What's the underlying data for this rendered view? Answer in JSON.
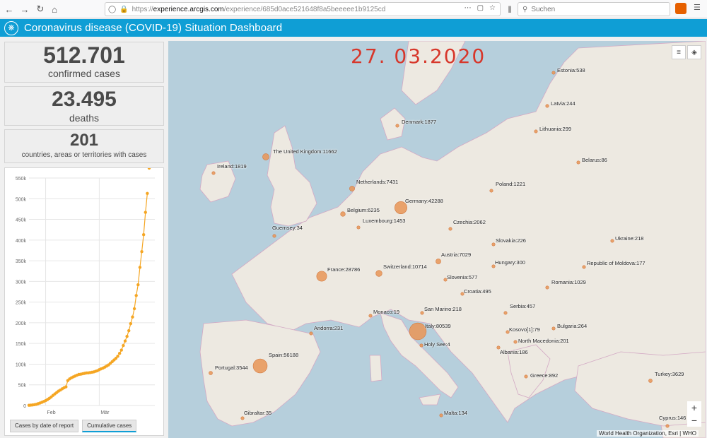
{
  "browser": {
    "url_scheme": "https://",
    "url_domain": "experience.arcgis.com",
    "url_path": "/experience/685d0ace521648f8a5beeeee1b9125cd",
    "search_placeholder": "Suchen"
  },
  "header": {
    "title": "Coronavirus disease (COVID-19) Situation Dashboard",
    "logo_icon": "who-emblem-icon"
  },
  "stats": {
    "confirmed_value": "512.701",
    "confirmed_label": "confirmed cases",
    "deaths_value": "23.495",
    "deaths_label": "deaths",
    "countries_value": "201",
    "countries_label": "countries, areas or territories with cases"
  },
  "chart_tabs": {
    "by_date": "Cases by date of report",
    "cumulative": "Cumulative cases"
  },
  "chart_data": {
    "type": "scatter",
    "ytick_labels": [
      "0",
      "50k",
      "100k",
      "150k",
      "200k",
      "250k",
      "300k",
      "350k",
      "400k",
      "450k",
      "500k",
      "550k"
    ],
    "xtick_labels": [
      "Feb",
      "Mär"
    ],
    "ylim": [
      0,
      550000
    ],
    "color": "#f5a623",
    "x": [
      1,
      2,
      3,
      4,
      5,
      6,
      7,
      8,
      9,
      10,
      11,
      12,
      13,
      14,
      15,
      16,
      17,
      18,
      19,
      20,
      21,
      22,
      23,
      24,
      25,
      26,
      27,
      28,
      29,
      30,
      31,
      32,
      33,
      34,
      35,
      36,
      37,
      38,
      39,
      40,
      41,
      42,
      43,
      44,
      45,
      46,
      47,
      48,
      49,
      50,
      51,
      52,
      53,
      54,
      55,
      56,
      57,
      58,
      59,
      60,
      61,
      62,
      63,
      64,
      65,
      66
    ],
    "y": [
      580,
      850,
      1300,
      2000,
      2800,
      4600,
      6000,
      7800,
      9800,
      11900,
      14500,
      17300,
      20500,
      24500,
      28000,
      31400,
      34900,
      37500,
      40500,
      43100,
      45100,
      60300,
      64400,
      67100,
      69200,
      71300,
      73300,
      75200,
      75700,
      76700,
      77700,
      78600,
      78900,
      79500,
      80400,
      81300,
      82700,
      84100,
      86600,
      88600,
      90400,
      92800,
      95300,
      98000,
      102000,
      106000,
      110000,
      114000,
      119000,
      126000,
      134000,
      145000,
      156000,
      167000,
      181000,
      198000,
      214000,
      234000,
      266000,
      292000,
      334000,
      372000,
      413000,
      467000,
      512701
    ],
    "grid": true
  },
  "map": {
    "date": "27. 03.2020",
    "attribution": "World Health Organization, Esri | WHO",
    "legend_icon": "list-icon",
    "layers_icon": "layers-icon",
    "zoom_in": "+",
    "zoom_out": "−",
    "markers": [
      {
        "label": "Estonia:538",
        "cases": 538
      },
      {
        "label": "Latvia:244",
        "cases": 244
      },
      {
        "label": "Lithuania:299",
        "cases": 299
      },
      {
        "label": "Denmark:1877",
        "cases": 1877
      },
      {
        "label": "Belarus:86",
        "cases": 86
      },
      {
        "label": "The United Kingdom:11662",
        "cases": 11662
      },
      {
        "label": "Ireland:1819",
        "cases": 1819
      },
      {
        "label": "Netherlands:7431",
        "cases": 7431
      },
      {
        "label": "Poland:1221",
        "cases": 1221
      },
      {
        "label": "Germany:42288",
        "cases": 42288
      },
      {
        "label": "Belgium:6235",
        "cases": 6235
      },
      {
        "label": "Luxembourg:1453",
        "cases": 1453
      },
      {
        "label": "Czechia:2062",
        "cases": 2062
      },
      {
        "label": "Guernsey:34",
        "cases": 34
      },
      {
        "label": "Ukraine:218",
        "cases": 218
      },
      {
        "label": "Slovakia:226",
        "cases": 226
      },
      {
        "label": "Austria:7029",
        "cases": 7029
      },
      {
        "label": "Republic of Moldova:177",
        "cases": 177
      },
      {
        "label": "France:28786",
        "cases": 28786
      },
      {
        "label": "Switzerland:10714",
        "cases": 10714
      },
      {
        "label": "Hungary:300",
        "cases": 300
      },
      {
        "label": "Slovenia:577",
        "cases": 577
      },
      {
        "label": "Romania:1029",
        "cases": 1029
      },
      {
        "label": "Croatia:495",
        "cases": 495
      },
      {
        "label": "Monaco:19",
        "cases": 19
      },
      {
        "label": "San Marino:218",
        "cases": 218
      },
      {
        "label": "Serbia:457",
        "cases": 457
      },
      {
        "label": "Andorra:231",
        "cases": 231
      },
      {
        "label": "Italy:80539",
        "cases": 80539
      },
      {
        "label": "Kosovo[1]:79",
        "cases": 79
      },
      {
        "label": "Bulgaria:264",
        "cases": 264
      },
      {
        "label": "Holy See:4",
        "cases": 4
      },
      {
        "label": "North Macedonia:201",
        "cases": 201
      },
      {
        "label": "Albania:186",
        "cases": 186
      },
      {
        "label": "Spain:56188",
        "cases": 56188
      },
      {
        "label": "Portugal:3544",
        "cases": 3544
      },
      {
        "label": "Greece:892",
        "cases": 892
      },
      {
        "label": "Turkey:3629",
        "cases": 3629
      },
      {
        "label": "Gibraltar:35",
        "cases": 35
      },
      {
        "label": "Malta:134",
        "cases": 134
      },
      {
        "label": "Cyprus:146",
        "cases": 146
      }
    ]
  }
}
